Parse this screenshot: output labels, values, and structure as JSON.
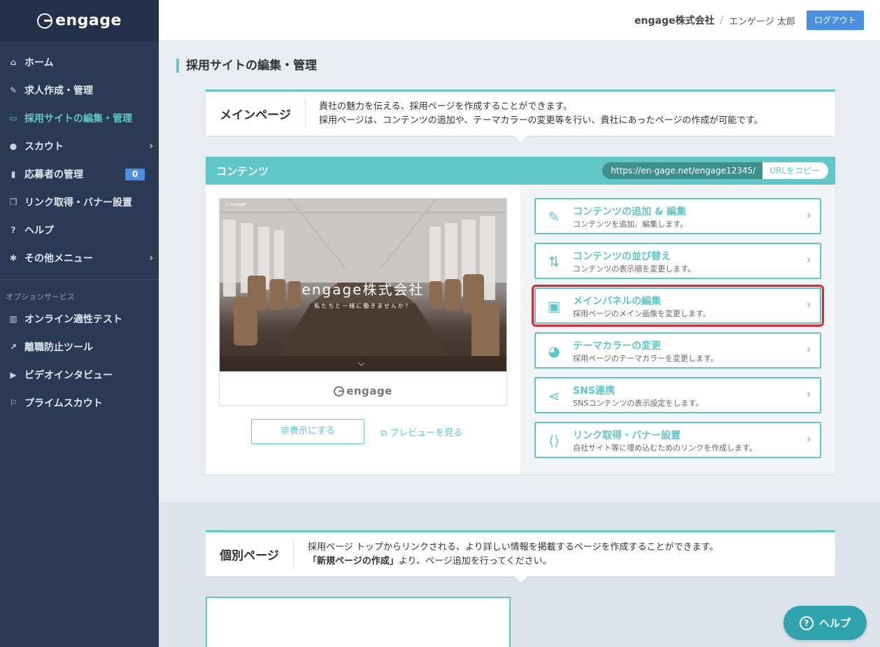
{
  "brand": {
    "name": "engage"
  },
  "sidebar": {
    "items": [
      {
        "icon": "home-icon",
        "glyph": "⌂",
        "label": "ホーム"
      },
      {
        "icon": "edit-icon",
        "glyph": "✎",
        "label": "求人作成・管理"
      },
      {
        "icon": "monitor-icon",
        "glyph": "▭",
        "label": "採用サイトの編集・管理",
        "active": true
      },
      {
        "icon": "person-icon",
        "glyph": "●",
        "label": "スカウト",
        "chevron": "›"
      },
      {
        "icon": "applicant-icon",
        "glyph": "▮",
        "label": "応募者の管理",
        "badge": "0"
      },
      {
        "icon": "link-file-icon",
        "glyph": "❐",
        "label": "リンク取得・バナー設置"
      },
      {
        "icon": "question-icon",
        "glyph": "?",
        "label": "ヘルプ"
      },
      {
        "icon": "gear-icon",
        "glyph": "✱",
        "label": "その他メニュー",
        "chevron": "›"
      }
    ],
    "section_title": "オプションサービス",
    "option_items": [
      {
        "icon": "bar-chart-icon",
        "glyph": "▥",
        "label": "オンライン適性テスト"
      },
      {
        "icon": "line-chart-icon",
        "glyph": "↗",
        "label": "離職防止ツール"
      },
      {
        "icon": "video-icon",
        "glyph": "▶",
        "label": "ビデオインタビュー"
      },
      {
        "icon": "bookmark-icon",
        "glyph": "⚐",
        "label": "プライムスカウト"
      }
    ]
  },
  "header": {
    "company": "engage株式会社",
    "separator": "/",
    "user": "エンゲージ 太郎",
    "logout": "ログアウト"
  },
  "page_title": "採用サイトの編集・管理",
  "main_page": {
    "label": "メインページ",
    "desc_line1": "貴社の魅力を伝える、採用ページを作成することができます。",
    "desc_line2": "採用ページは、コンテンツの追加や、テーマカラーの変更等を行い、貴社にあったページの作成が可能です。"
  },
  "contents": {
    "title": "コンテンツ",
    "url": "https://en-gage.net/engage12345/",
    "copy_label": "URLをコピー",
    "preview": {
      "company_name": "engage株式会社",
      "tagline": "私たちと一緒に働きませんか？",
      "footer_logo": "engage"
    },
    "hide_button": "非表示にする",
    "preview_link": "プレビューを見る",
    "actions": [
      {
        "icon": "pencil-icon",
        "glyph": "✎",
        "title": "コンテンツの追加 & 編集",
        "sub": "コンテンツを追加、編集します。"
      },
      {
        "icon": "sort-icon",
        "glyph": "⇅",
        "title": "コンテンツの並び替え",
        "sub": "コンテンツの表示順を変更します。"
      },
      {
        "icon": "panel-icon",
        "glyph": "▣",
        "title": "メインパネルの編集",
        "sub": "採用ページのメイン画像を変更します。",
        "highlighted": true
      },
      {
        "icon": "palette-icon",
        "glyph": "◕",
        "title": "テーマカラーの変更",
        "sub": "採用ページのテーマカラーを変更します。"
      },
      {
        "icon": "share-icon",
        "glyph": "⋖",
        "title": "SNS連携",
        "sub": "SNSコンテンツの表示設定をします。"
      },
      {
        "icon": "code-file-icon",
        "glyph": "⟨⟩",
        "title": "リンク取得・バナー設置",
        "sub": "自社サイト等に埋め込むためのリンクを作成します。"
      }
    ]
  },
  "individual_page": {
    "label": "個別ページ",
    "desc_line1": "採用ページ トップからリンクされる、より詳しい情報を掲載するページを作成することができます。",
    "desc_line2_bold": "「新規ページの作成」",
    "desc_line2_rest": "より、ページ追加を行ってください。"
  },
  "help_button": "ヘルプ",
  "colors": {
    "accent": "#5fc7c7",
    "sidebar": "#2b3a54",
    "highlight": "#e0252b",
    "logout": "#4a90e2"
  }
}
